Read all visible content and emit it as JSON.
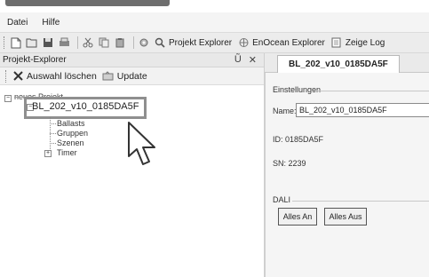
{
  "menu": {
    "items": [
      "Datei",
      "Hilfe"
    ]
  },
  "toolbar": {
    "icons": [
      "new-icon",
      "open-icon",
      "save-icon",
      "print-icon",
      "cut-icon",
      "copy-icon",
      "paste-icon",
      "settings-icon",
      "search-icon"
    ],
    "project_explorer_label": "Projekt Explorer",
    "enocean_explorer_label": "EnOcean Explorer",
    "show_log_label": "Zeige Log"
  },
  "explorer": {
    "title": "Projekt-Explorer",
    "pin_glyph": "Ũ",
    "close_glyph": "✕",
    "clear_selection_label": "Auswahl löschen",
    "update_label": "Update",
    "tree": {
      "root_label": "neues Projekt",
      "device_label": "BL_202_v10_0185DA5F",
      "children": [
        "Ballasts",
        "Gruppen",
        "Szenen",
        "Timer"
      ]
    }
  },
  "document": {
    "tab_label": "BL_202_v10_0185DA5F",
    "settings_group": "Einstellungen",
    "name_label": "Name:",
    "name_value": "BL_202_v10_0185DA5F",
    "id_text": "ID: 0185DA5F",
    "sn_text": "SN: 2239",
    "dali_group": "DALI",
    "all_on_label": "Alles An",
    "all_off_label": "Alles Aus"
  }
}
